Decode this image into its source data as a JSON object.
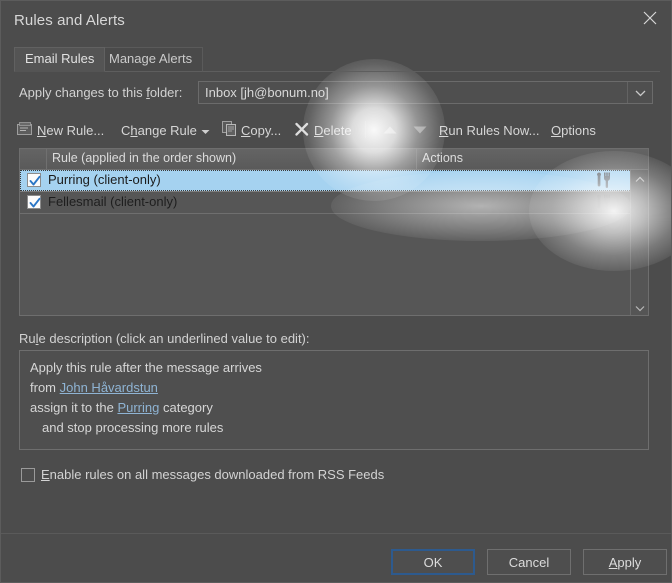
{
  "window": {
    "title": "Rules and Alerts",
    "close_icon": "close-icon"
  },
  "tabs": [
    {
      "label": "Email Rules",
      "active": true
    },
    {
      "label": "Manage Alerts",
      "active": false
    }
  ],
  "folder": {
    "label": "Apply changes to this folder:",
    "value": "Inbox [jh@bonum.no]",
    "dropdown_icon": "chevron-down-icon"
  },
  "toolbar": {
    "new_rule": "New Rule...",
    "change_rule": "Change Rule",
    "copy": "Copy...",
    "delete": "Delete",
    "move_up_icon": "arrow-up-icon",
    "move_down_icon": "arrow-down-icon",
    "run_rules_now": "Run Rules Now...",
    "options": "Options"
  },
  "list": {
    "columns": [
      "Rule (applied in the order shown)",
      "Actions"
    ],
    "rows": [
      {
        "name": "Purring  (client-only)",
        "checked": true,
        "selected": true,
        "action_icon": "tools-icon"
      },
      {
        "name": "Fellesmail  (client-only)",
        "checked": true,
        "selected": false,
        "action_icon": "tools-icon"
      }
    ],
    "scroll_up_icon": "chevron-up-icon",
    "scroll_down_icon": "chevron-down-icon"
  },
  "description": {
    "label": "Rule description (click an underlined value to edit):",
    "lines": [
      {
        "pre": "Apply this rule after the message arrives",
        "link": "",
        "post": ""
      },
      {
        "pre": "from ",
        "link": "John Håvardstun",
        "post": ""
      },
      {
        "pre": "assign it to the ",
        "link": "Purring",
        "post": " category"
      },
      {
        "pre": "and stop processing more rules",
        "link": "",
        "post": ""
      }
    ]
  },
  "rss": {
    "label": "Enable rules on all messages downloaded from RSS Feeds",
    "checked": false
  },
  "footer": {
    "ok": "OK",
    "cancel": "Cancel",
    "apply": "Apply"
  },
  "colors": {
    "dialog_bg": "#4c4c4c",
    "selection_blue": "#a5d2f0",
    "link_blue": "#8fb4d4",
    "focus_border": "#2d5a8e"
  }
}
